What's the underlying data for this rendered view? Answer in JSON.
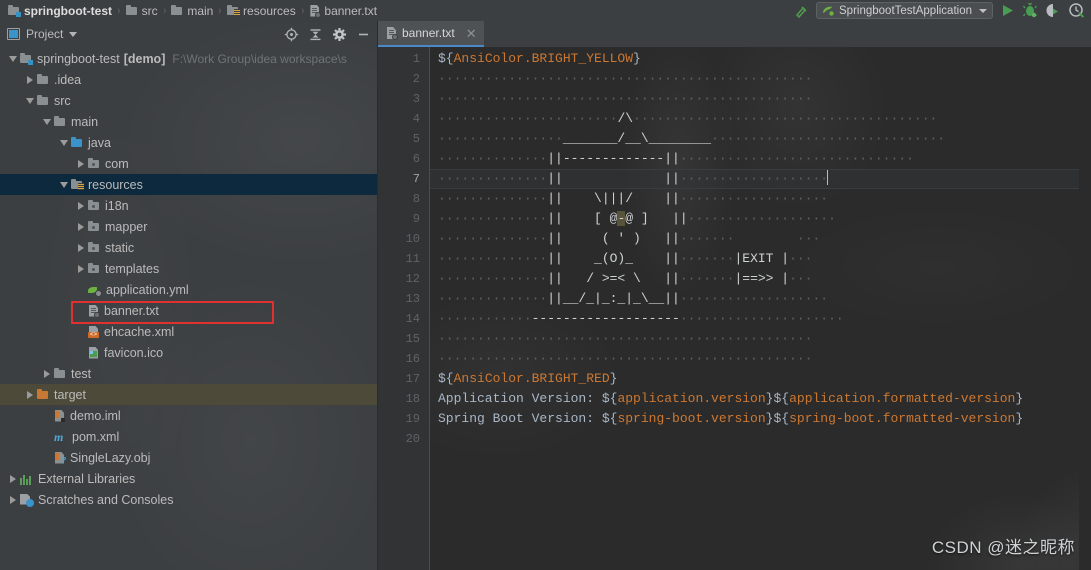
{
  "window": {
    "breadcrumbs": [
      {
        "label": "springboot-test",
        "icon": "module-icon"
      },
      {
        "label": "src",
        "icon": "folder-icon"
      },
      {
        "label": "main",
        "icon": "folder-icon"
      },
      {
        "label": "resources",
        "icon": "resources-folder-icon"
      },
      {
        "label": "banner.txt",
        "icon": "text-file-icon"
      }
    ],
    "separator": "›"
  },
  "toolbar": {
    "build_icon": "hammer-icon",
    "run_configuration": "SpringbootTestApplication",
    "run_config_icon": "spring-boot-icon",
    "dropdown_icon": "chevron-down-icon",
    "actions": [
      {
        "name": "run-button",
        "icon": "play-icon"
      },
      {
        "name": "debug-button",
        "icon": "bug-icon"
      },
      {
        "name": "run-with-coverage-button",
        "icon": "coverage-icon"
      },
      {
        "name": "profile-button",
        "icon": "profiler-icon"
      }
    ]
  },
  "project_panel": {
    "title": "Project",
    "title_icon": "project-window-icon",
    "dropdown_icon": "chevron-down-icon",
    "actions": [
      {
        "name": "select-opened-file-button",
        "icon": "crosshair-target-icon"
      },
      {
        "name": "collapse-all-button",
        "icon": "collapse-all-icon"
      },
      {
        "name": "settings-button",
        "icon": "gear-icon"
      },
      {
        "name": "hide-button",
        "icon": "minimize-icon"
      }
    ],
    "tree": [
      {
        "label": "springboot-test",
        "bold_suffix": "[demo]",
        "path": "F:\\Work Group\\idea workspace\\s",
        "indent": 0,
        "twisty": "down",
        "icon": "module-icon",
        "state": "none"
      },
      {
        "label": ".idea",
        "indent": 1,
        "twisty": "right",
        "icon": "folder-icon",
        "state": "none"
      },
      {
        "label": "src",
        "indent": 1,
        "twisty": "down",
        "icon": "folder-icon",
        "state": "none"
      },
      {
        "label": "main",
        "indent": 2,
        "twisty": "down",
        "icon": "folder-icon",
        "state": "none"
      },
      {
        "label": "java",
        "indent": 3,
        "twisty": "down",
        "icon": "source-folder-icon",
        "state": "none"
      },
      {
        "label": "com",
        "indent": 4,
        "twisty": "right",
        "icon": "package-folder-icon",
        "state": "none"
      },
      {
        "label": "resources",
        "indent": 3,
        "twisty": "down",
        "icon": "resources-folder-icon",
        "state": "selected"
      },
      {
        "label": "i18n",
        "indent": 4,
        "twisty": "right",
        "icon": "package-folder-icon",
        "state": "none"
      },
      {
        "label": "mapper",
        "indent": 4,
        "twisty": "right",
        "icon": "package-folder-icon",
        "state": "none"
      },
      {
        "label": "static",
        "indent": 4,
        "twisty": "right",
        "icon": "package-folder-icon",
        "state": "none"
      },
      {
        "label": "templates",
        "indent": 4,
        "twisty": "right",
        "icon": "package-folder-icon",
        "state": "none"
      },
      {
        "label": "application.yml",
        "indent": 4,
        "twisty": "none",
        "icon": "spring-yaml-icon",
        "state": "none"
      },
      {
        "label": "banner.txt",
        "indent": 4,
        "twisty": "none",
        "icon": "text-file-icon",
        "state": "highlighted"
      },
      {
        "label": "ehcache.xml",
        "indent": 4,
        "twisty": "none",
        "icon": "xml-file-icon",
        "state": "none"
      },
      {
        "label": "favicon.ico",
        "indent": 4,
        "twisty": "none",
        "icon": "image-file-icon",
        "state": "none"
      },
      {
        "label": "test",
        "indent": 2,
        "twisty": "right",
        "icon": "folder-icon",
        "state": "none"
      },
      {
        "label": "target",
        "indent": 1,
        "twisty": "right",
        "icon": "excluded-folder-icon",
        "state": "inactive-selected"
      },
      {
        "label": "demo.iml",
        "indent": 2,
        "twisty": "none",
        "icon": "module-file-icon",
        "state": "none"
      },
      {
        "label": "pom.xml",
        "indent": 2,
        "twisty": "none",
        "icon": "maven-icon",
        "state": "none"
      },
      {
        "label": "SingleLazy.obj",
        "indent": 2,
        "twisty": "none",
        "icon": "unknown-file-icon",
        "state": "none"
      },
      {
        "label": "External Libraries",
        "indent": 0,
        "twisty": "right",
        "icon": "libraries-icon",
        "state": "none"
      },
      {
        "label": "Scratches and Consoles",
        "indent": 0,
        "twisty": "right",
        "icon": "scratches-icon",
        "state": "none"
      }
    ]
  },
  "editor": {
    "tabs": [
      {
        "label": "banner.txt",
        "icon": "text-file-icon",
        "active": true,
        "close_icon": "close-icon"
      }
    ],
    "current_line": 7,
    "total_lines": 20,
    "line_numbers": [
      1,
      2,
      3,
      4,
      5,
      6,
      7,
      8,
      9,
      10,
      11,
      12,
      13,
      14,
      15,
      16,
      17,
      18,
      19,
      20
    ],
    "lines": [
      {
        "n": 1,
        "segments": [
          {
            "t": "${",
            "c": "dollar"
          },
          {
            "t": "AnsiColor.BRIGHT_YELLOW",
            "c": "prop"
          },
          {
            "t": "}",
            "c": "dollar"
          }
        ]
      },
      {
        "n": 2,
        "segments": [
          {
            "t": "················································",
            "c": "ws"
          }
        ]
      },
      {
        "n": 3,
        "segments": [
          {
            "t": "················································",
            "c": "ws"
          }
        ]
      },
      {
        "n": 4,
        "segments": [
          {
            "t": "·······················",
            "c": "ws"
          },
          {
            "t": "/\\",
            "c": "art"
          },
          {
            "t": "·······································",
            "c": "ws"
          }
        ]
      },
      {
        "n": 5,
        "segments": [
          {
            "t": "················",
            "c": "ws"
          },
          {
            "t": "_______/__\\________",
            "c": "art"
          },
          {
            "t": "······························",
            "c": "ws"
          }
        ]
      },
      {
        "n": 6,
        "segments": [
          {
            "t": "··············",
            "c": "ws"
          },
          {
            "t": "||-------------||",
            "c": "art"
          },
          {
            "t": "······························",
            "c": "ws"
          }
        ]
      },
      {
        "n": 7,
        "segments": [
          {
            "t": "··············",
            "c": "ws"
          },
          {
            "t": "||",
            "c": "art"
          },
          {
            "t": "             ",
            "c": "plain"
          },
          {
            "t": "||",
            "c": "art"
          },
          {
            "t": "···················",
            "c": "ws"
          }
        ]
      },
      {
        "n": 8,
        "segments": [
          {
            "t": "··············",
            "c": "ws"
          },
          {
            "t": "||",
            "c": "art"
          },
          {
            "t": "    \\|||/    ",
            "c": "art"
          },
          {
            "t": "||",
            "c": "art"
          },
          {
            "t": "···················",
            "c": "ws"
          }
        ]
      },
      {
        "n": 9,
        "segments": [
          {
            "t": "··············",
            "c": "ws"
          },
          {
            "t": "||",
            "c": "art"
          },
          {
            "t": "    [ @",
            "c": "art"
          },
          {
            "t": "-",
            "c": "hl"
          },
          {
            "t": "@ ]   ",
            "c": "art"
          },
          {
            "t": "||",
            "c": "art"
          },
          {
            "t": "···················",
            "c": "ws"
          }
        ]
      },
      {
        "n": 10,
        "segments": [
          {
            "t": "··············",
            "c": "ws"
          },
          {
            "t": "||",
            "c": "art"
          },
          {
            "t": "     ( ' )   ",
            "c": "art"
          },
          {
            "t": "||",
            "c": "art"
          },
          {
            "t": "·······",
            "c": "ws"
          },
          {
            "t": "        ",
            "c": "plain"
          },
          {
            "t": "···",
            "c": "ws"
          }
        ]
      },
      {
        "n": 11,
        "segments": [
          {
            "t": "··············",
            "c": "ws"
          },
          {
            "t": "||",
            "c": "art"
          },
          {
            "t": "    _(O)_    ",
            "c": "art"
          },
          {
            "t": "||",
            "c": "art"
          },
          {
            "t": "·······",
            "c": "ws"
          },
          {
            "t": "|EXIT |",
            "c": "art"
          },
          {
            "t": "···",
            "c": "ws"
          }
        ]
      },
      {
        "n": 12,
        "segments": [
          {
            "t": "··············",
            "c": "ws"
          },
          {
            "t": "||",
            "c": "art"
          },
          {
            "t": "   / >=< \\   ",
            "c": "art"
          },
          {
            "t": "||",
            "c": "art"
          },
          {
            "t": "·······",
            "c": "ws"
          },
          {
            "t": "|==>> |",
            "c": "art"
          },
          {
            "t": "···",
            "c": "ws"
          }
        ]
      },
      {
        "n": 13,
        "segments": [
          {
            "t": "··············",
            "c": "ws"
          },
          {
            "t": "||__/_|_:_|_\\__||",
            "c": "art"
          },
          {
            "t": "···················",
            "c": "ws"
          }
        ]
      },
      {
        "n": 14,
        "segments": [
          {
            "t": "············",
            "c": "ws"
          },
          {
            "t": "-------------------",
            "c": "art"
          },
          {
            "t": "·····················",
            "c": "ws"
          }
        ]
      },
      {
        "n": 15,
        "segments": [
          {
            "t": "················································",
            "c": "ws"
          }
        ]
      },
      {
        "n": 16,
        "segments": [
          {
            "t": "················································",
            "c": "ws"
          }
        ]
      },
      {
        "n": 17,
        "segments": [
          {
            "t": "${",
            "c": "dollar"
          },
          {
            "t": "AnsiColor.BRIGHT_RED",
            "c": "prop"
          },
          {
            "t": "}",
            "c": "dollar"
          }
        ]
      },
      {
        "n": 18,
        "segments": [
          {
            "t": "Application Version: ",
            "c": "plain"
          },
          {
            "t": "${",
            "c": "dollar"
          },
          {
            "t": "application.version",
            "c": "prop"
          },
          {
            "t": "}",
            "c": "dollar"
          },
          {
            "t": "${",
            "c": "dollar"
          },
          {
            "t": "application.formatted-version",
            "c": "prop"
          },
          {
            "t": "}",
            "c": "dollar"
          }
        ]
      },
      {
        "n": 19,
        "segments": [
          {
            "t": "Spring Boot Version: ",
            "c": "plain"
          },
          {
            "t": "${",
            "c": "dollar"
          },
          {
            "t": "spring-boot.version",
            "c": "prop"
          },
          {
            "t": "}",
            "c": "dollar"
          },
          {
            "t": "${",
            "c": "dollar"
          },
          {
            "t": "spring-boot.formatted-version",
            "c": "prop"
          },
          {
            "t": "}",
            "c": "dollar"
          }
        ]
      },
      {
        "n": 20,
        "segments": []
      }
    ]
  },
  "watermark": "CSDN @迷之昵称",
  "colors": {
    "panel_bg": "#3c3f41",
    "editor_bg": "#2b2b2b",
    "gutter_bg": "#313335",
    "selection_blue": "#0d293e",
    "inactive_selection": "#4e4a39",
    "tab_underline": "#4a88c7",
    "property_orange": "#cc7832",
    "text_default": "#a9b7c6",
    "highlight_red_box": "#e03030",
    "run_green": "#499c54",
    "spring_green": "#6db33f"
  }
}
